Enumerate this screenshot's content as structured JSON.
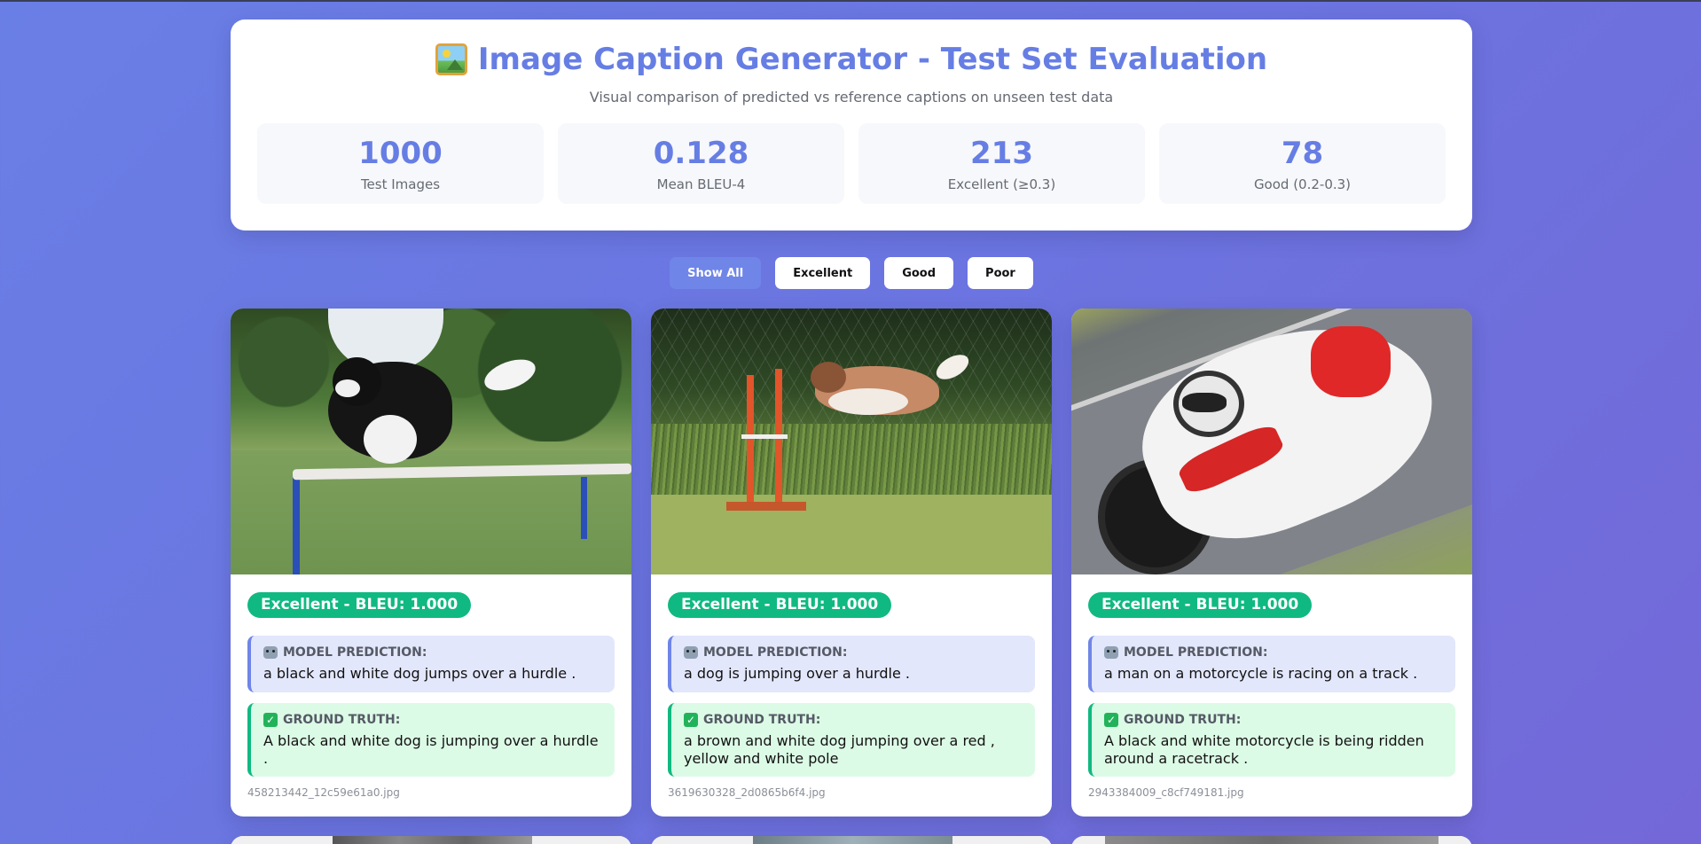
{
  "header": {
    "title": "Image Caption Generator - Test Set Evaluation",
    "title_icon": "framed-picture-icon",
    "subtitle": "Visual comparison of predicted vs reference captions on unseen test data"
  },
  "stats": [
    {
      "value": "1000",
      "label": "Test Images"
    },
    {
      "value": "0.128",
      "label": "Mean BLEU-4"
    },
    {
      "value": "213",
      "label": "Excellent (≥0.3)"
    },
    {
      "value": "78",
      "label": "Good (0.2-0.3)"
    }
  ],
  "filters": {
    "show_all": "Show All",
    "excellent": "Excellent",
    "good": "Good",
    "poor": "Poor",
    "active": "Show All"
  },
  "labels": {
    "prediction": "MODEL PREDICTION:",
    "ground_truth": "GROUND TRUTH:"
  },
  "colors": {
    "accent": "#667ee4",
    "excellent": "#10b981"
  },
  "cards": [
    {
      "badge": "Excellent - BLEU: 1.000",
      "prediction": "a black and white dog jumps over a hurdle .",
      "ground_truth": "A black and white dog is jumping over a hurdle .",
      "filename": "458213442_12c59e61a0.jpg"
    },
    {
      "badge": "Excellent - BLEU: 1.000",
      "prediction": "a dog is jumping over a hurdle .",
      "ground_truth": "a brown and white dog jumping over a red , yellow and white pole",
      "filename": "3619630328_2d0865b6f4.jpg"
    },
    {
      "badge": "Excellent - BLEU: 1.000",
      "prediction": "a man on a motorcycle is racing on a track .",
      "ground_truth": "A black and white motorcycle is being ridden around a racetrack .",
      "filename": "2943384009_c8cf749181.jpg"
    }
  ]
}
